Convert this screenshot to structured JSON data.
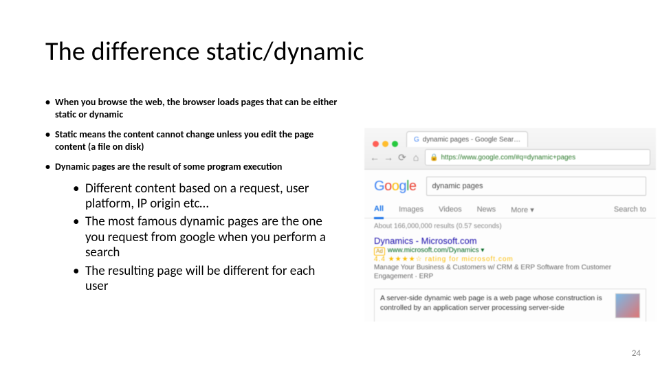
{
  "title": "The difference static/dynamic",
  "bullets": {
    "b1": "When you browse the web, the browser loads pages that can be either static or dynamic",
    "b2": "Static means the content cannot change unless you edit the page content (a file on disk)",
    "b3": "Dynamic pages are the result of some program execution"
  },
  "sub": {
    "s1": "Different content based on a request, user platform, IP origin etc…",
    "s2": "The most famous dynamic pages are the one you request from google when you perform a search",
    "s3": "The resulting page will be different for each user"
  },
  "shot": {
    "tab_label": "dynamic pages - Google Sear…",
    "url": "https://www.google.com/#q=dynamic+pages",
    "logo": {
      "g": "G",
      "o1": "o",
      "o2": "o",
      "g2": "g",
      "l": "l",
      "e": "e"
    },
    "query": "dynamic pages",
    "tabs": {
      "all": "All",
      "images": "Images",
      "videos": "Videos",
      "news": "News",
      "more": "More ▾",
      "tools": "Search to"
    },
    "stats": "About 166,000,000 results (0.57 seconds)",
    "ad": {
      "title": "Dynamics - Microsoft.com",
      "url_line": "www.microsoft.com/Dynamics ▾",
      "badge": "Ad",
      "rating_text": "4.4 ★★★★☆  rating for microsoft.com",
      "desc": "Manage Your Business & Customers w/ CRM & ERP Software from Customer Engagement · ERP"
    },
    "snippet": {
      "line": "A server-side dynamic web page is a web page whose construction is controlled by an application server processing server-side"
    }
  },
  "page_number": "24"
}
